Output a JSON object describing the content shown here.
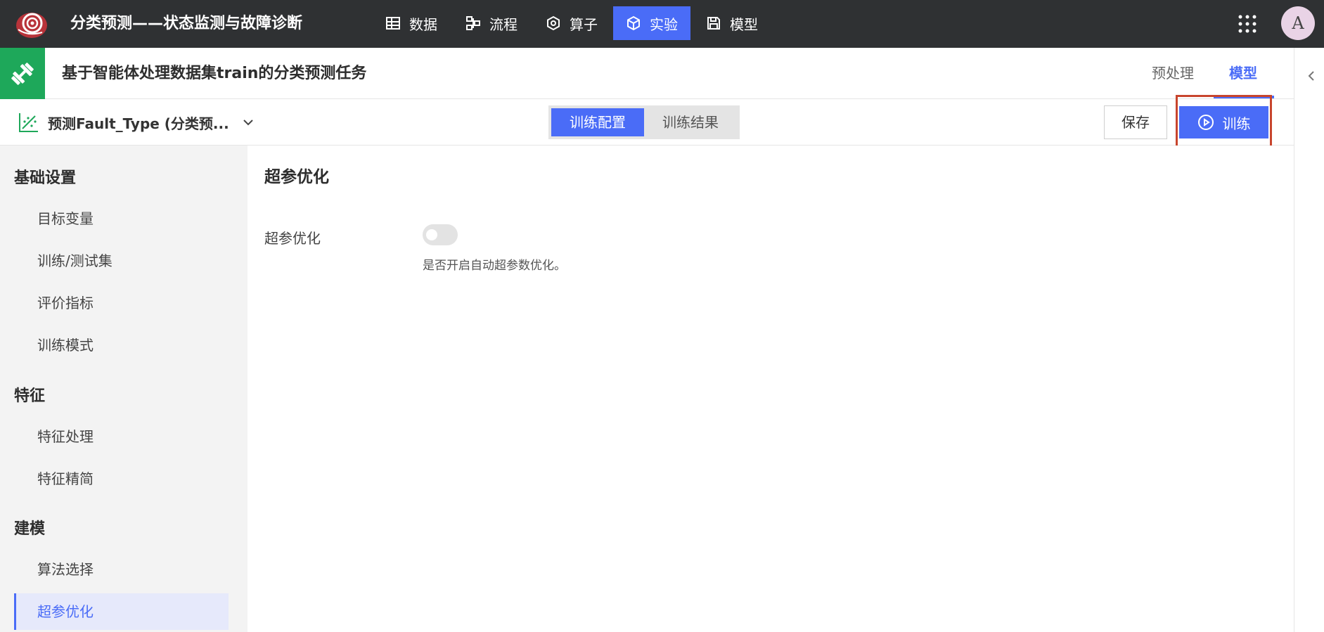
{
  "topbar": {
    "app_title": "分类预测——状态监测与故障诊断",
    "nav": [
      {
        "label": "数据",
        "icon": "table-icon"
      },
      {
        "label": "流程",
        "icon": "flow-icon"
      },
      {
        "label": "算子",
        "icon": "hexagon-icon"
      },
      {
        "label": "实验",
        "icon": "cube-icon",
        "active": true
      },
      {
        "label": "模型",
        "icon": "save-icon"
      }
    ],
    "avatar_letter": "A",
    "accent_color": "#4a6cf7",
    "bar_color": "#2f3133"
  },
  "task": {
    "title": "基于智能体处理数据集train的分类预测任务",
    "tabs": [
      {
        "label": "预处理",
        "active": false
      },
      {
        "label": "模型",
        "active": true
      }
    ],
    "icon_color": "#1ea85a"
  },
  "toolbar": {
    "model_label": "预测Fault_Type (分类预...",
    "segments": [
      {
        "label": "训练配置",
        "active": true
      },
      {
        "label": "训练结果",
        "active": false
      }
    ],
    "save_label": "保存",
    "train_label": "训练"
  },
  "sidebar": {
    "groups": [
      {
        "title": "基础设置",
        "items": [
          "目标变量",
          "训练/测试集",
          "评价指标",
          "训练模式"
        ]
      },
      {
        "title": "特征",
        "items": [
          "特征处理",
          "特征精简"
        ]
      },
      {
        "title": "建模",
        "items": [
          "算法选择",
          "超参优化"
        ]
      }
    ],
    "active_item": "超参优化"
  },
  "main": {
    "section_title": "超参优化",
    "field_label": "超参优化",
    "toggle_on": false,
    "field_desc": "是否开启自动超参数优化。"
  }
}
